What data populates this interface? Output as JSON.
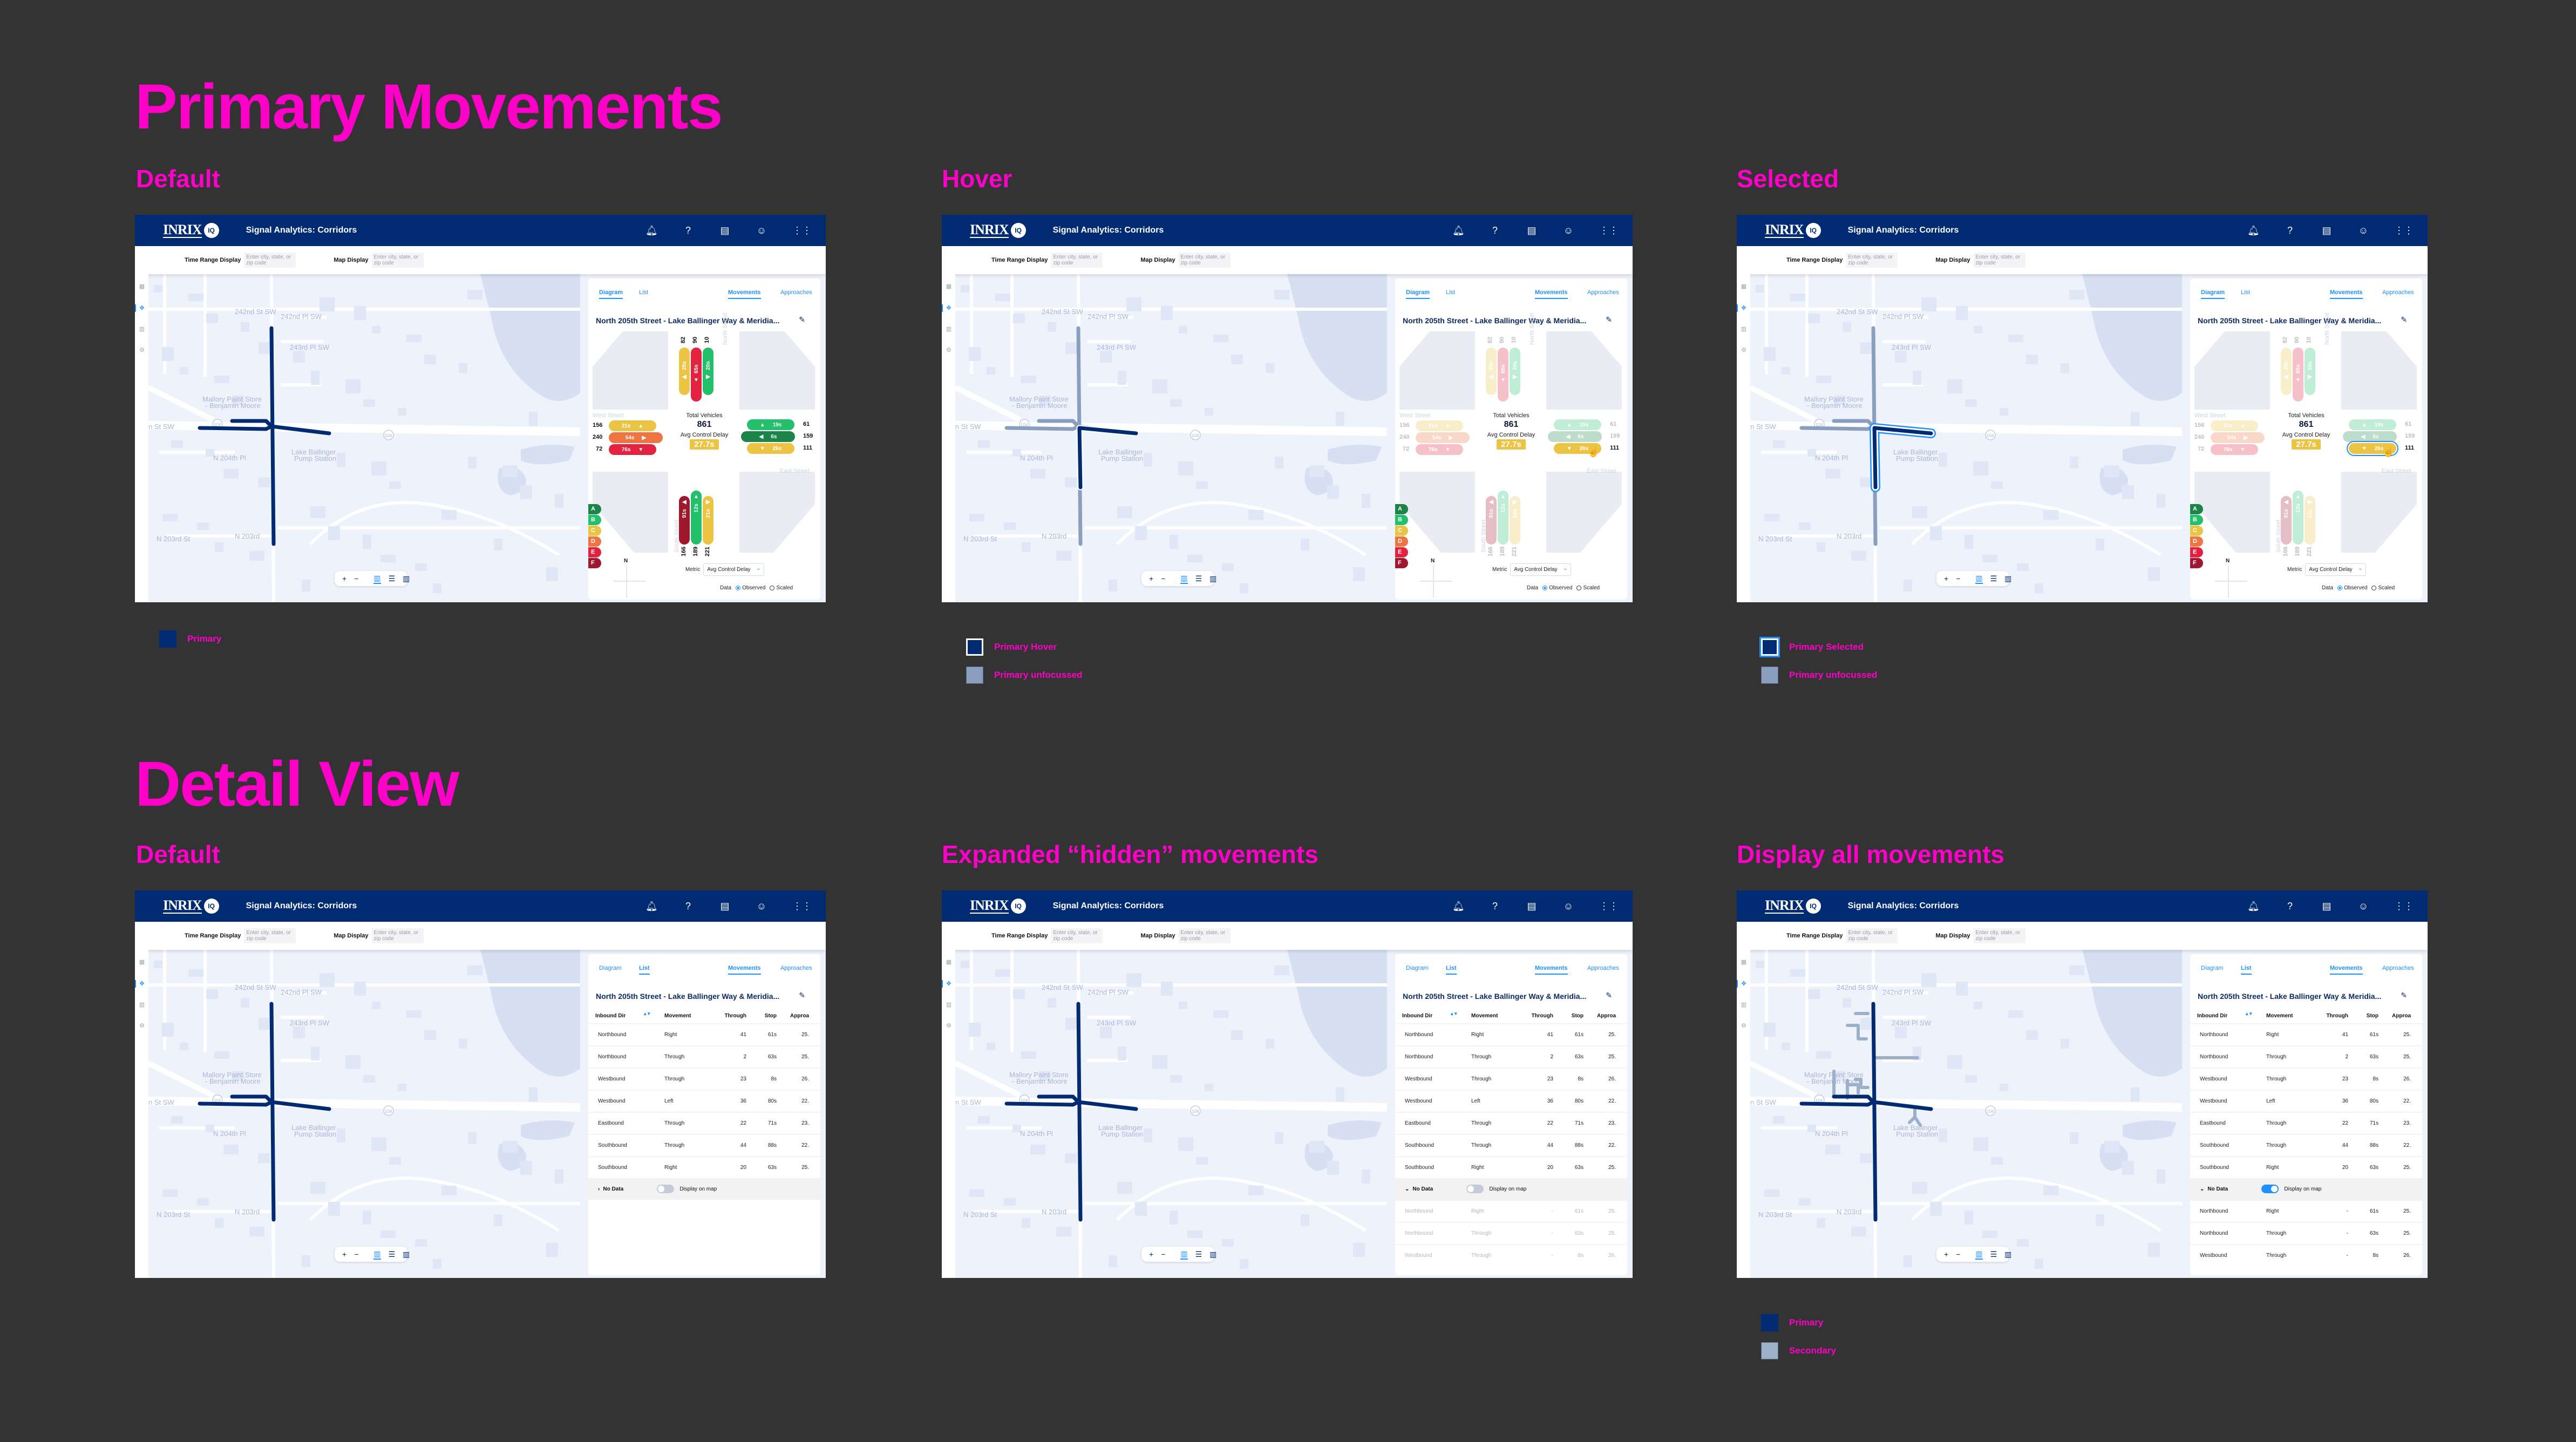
{
  "board": {
    "section_primary": "Primary Movements",
    "section_detail": "Detail View"
  },
  "colors": {
    "annotation": "#ff00c8",
    "header_bg": "#002b73",
    "primary": "#002b73",
    "primary_unfocussed": "#8a9ebf",
    "secondary": "#9cb0c8",
    "accent": "#1e90ff",
    "los_A": "#1b8547",
    "los_B": "#22c06b",
    "los_C": "#ebc443",
    "los_D": "#ee7542",
    "los_E": "#e2223f",
    "los_F": "#a0182e"
  },
  "app": {
    "logo_text": "INRIX",
    "logo_badge": "IQ",
    "title": "Signal Analytics: Corridors",
    "header_icons": [
      "bell-icon",
      "help-icon",
      "document-icon",
      "user-icon",
      "apps-grid-icon"
    ],
    "time_range_label": "Time Range Display",
    "time_range_placeholder": "Enter city, state, or zip code",
    "map_display_label": "Map Display",
    "map_display_placeholder": "Enter city, state, or zip code",
    "map_labels": {
      "st1": "242nd St SW",
      "st2": "242nd Pl SW",
      "st3": "243rd Pl SW",
      "poi1a": "Mallory Paint Store",
      "poi1b": "- Benjamin Moore",
      "poi2a": "Lake Ballinger",
      "poi2b": "Pump Station",
      "st4": "N 204th Pl",
      "st5": "N 203rd St",
      "st6": "N 203rd",
      "st7": "n St SW",
      "route": "104",
      "gas": "76"
    },
    "map_controls": {
      "zoom_in": "+",
      "zoom_out": "−",
      "map": "▥",
      "list": "☰",
      "split": "▥"
    },
    "tabs": {
      "diagram": "Diagram",
      "list": "List",
      "movements": "Movements",
      "approaches": "Approaches"
    },
    "intersection_title": "North 205th Street - Lake Ballinger Way & Meridia...",
    "diagram": {
      "street_north": "North Street",
      "street_south": "South Street",
      "street_west": "West Street",
      "street_east": "East Street",
      "total_label": "Total Vehicles",
      "total_value": "861",
      "avg_label": "Avg Control Delay",
      "avg_value": "27.7s",
      "north": [
        {
          "volume": "82",
          "delay": "20s",
          "arrow": "◀",
          "los": "C"
        },
        {
          "volume": "90",
          "delay": "65s",
          "arrow": "▼",
          "los": "E"
        },
        {
          "volume": "10",
          "delay": "20s",
          "arrow": "▶",
          "los": "B"
        }
      ],
      "south": [
        {
          "volume": "166",
          "delay": "91s",
          "arrow": "◀",
          "los": "F"
        },
        {
          "volume": "189",
          "delay": "12s",
          "arrow": "▲",
          "los": "B"
        },
        {
          "volume": "221",
          "delay": "21s",
          "arrow": "▶",
          "los": "C"
        }
      ],
      "west": [
        {
          "volume": "156",
          "delay": "21s",
          "arrow": "▲",
          "los": "C"
        },
        {
          "volume": "240",
          "delay": "54s",
          "arrow": "▶",
          "los": "D"
        },
        {
          "volume": "72",
          "delay": "76s",
          "arrow": "▼",
          "los": "E"
        }
      ],
      "east": [
        {
          "volume": "61",
          "delay": "19s",
          "arrow": "▲",
          "los": "B"
        },
        {
          "volume": "159",
          "delay": "6s",
          "arrow": "◀",
          "los": "A"
        },
        {
          "volume": "111",
          "delay": "26s",
          "arrow": "▼",
          "los": "C"
        }
      ],
      "los_scale": [
        "A",
        "B",
        "C",
        "D",
        "E",
        "F"
      ],
      "compass": "N",
      "metric_label": "Metric",
      "metric_value": "Avg Control Delay",
      "data_label": "Data",
      "data_options": [
        "Observed",
        "Scaled"
      ],
      "data_selected": "Observed"
    },
    "list": {
      "columns": [
        "Inbound Dir",
        "Movement",
        "Through",
        "Stop",
        "Approa"
      ],
      "rows": [
        {
          "dir": "Northbound",
          "movement": "Right",
          "through": "41",
          "stop": "61s",
          "approach": "25."
        },
        {
          "dir": "Northbound",
          "movement": "Through",
          "through": "2",
          "stop": "63s",
          "approach": "25."
        },
        {
          "dir": "Westbound",
          "movement": "Through",
          "through": "23",
          "stop": "8s",
          "approach": "26."
        },
        {
          "dir": "Westbound",
          "movement": "Left",
          "through": "36",
          "stop": "80s",
          "approach": "22."
        },
        {
          "dir": "Eastbound",
          "movement": "Through",
          "through": "22",
          "stop": "71s",
          "approach": "23."
        },
        {
          "dir": "Southbound",
          "movement": "Through",
          "through": "44",
          "stop": "88s",
          "approach": "22."
        },
        {
          "dir": "Southbound",
          "movement": "Right",
          "through": "20",
          "stop": "63s",
          "approach": "25."
        }
      ],
      "no_data_label": "No Data",
      "display_on_map_label": "Display on map",
      "hidden_rows": [
        {
          "dir": "Northbound",
          "movement": "Right",
          "through": "-",
          "stop": "61s",
          "approach": "25."
        },
        {
          "dir": "Northbound",
          "movement": "Through",
          "through": "-",
          "stop": "63s",
          "approach": "25."
        },
        {
          "dir": "Westbound",
          "movement": "Through",
          "through": "-",
          "stop": "8s",
          "approach": "26."
        }
      ]
    }
  },
  "frames": [
    {
      "state": "Default",
      "legend": [
        {
          "label": "Primary",
          "swatch": "primary"
        }
      ]
    },
    {
      "state": "Hover",
      "legend": [
        {
          "label": "Primary Hover",
          "swatch": "primary-hover"
        },
        {
          "label": "Primary unfocussed",
          "swatch": "unfocussed"
        }
      ]
    },
    {
      "state": "Selected",
      "legend": [
        {
          "label": "Primary Selected",
          "swatch": "primary-selected"
        },
        {
          "label": "Primary unfocussed",
          "swatch": "unfocussed"
        }
      ]
    },
    {
      "state": "Default",
      "legend": []
    },
    {
      "state": "Expanded “hidden” movements",
      "legend": []
    },
    {
      "state": "Display all movements",
      "legend": [
        {
          "label": "Primary",
          "swatch": "primary"
        },
        {
          "label": "Secondary",
          "swatch": "secondary"
        }
      ]
    }
  ]
}
